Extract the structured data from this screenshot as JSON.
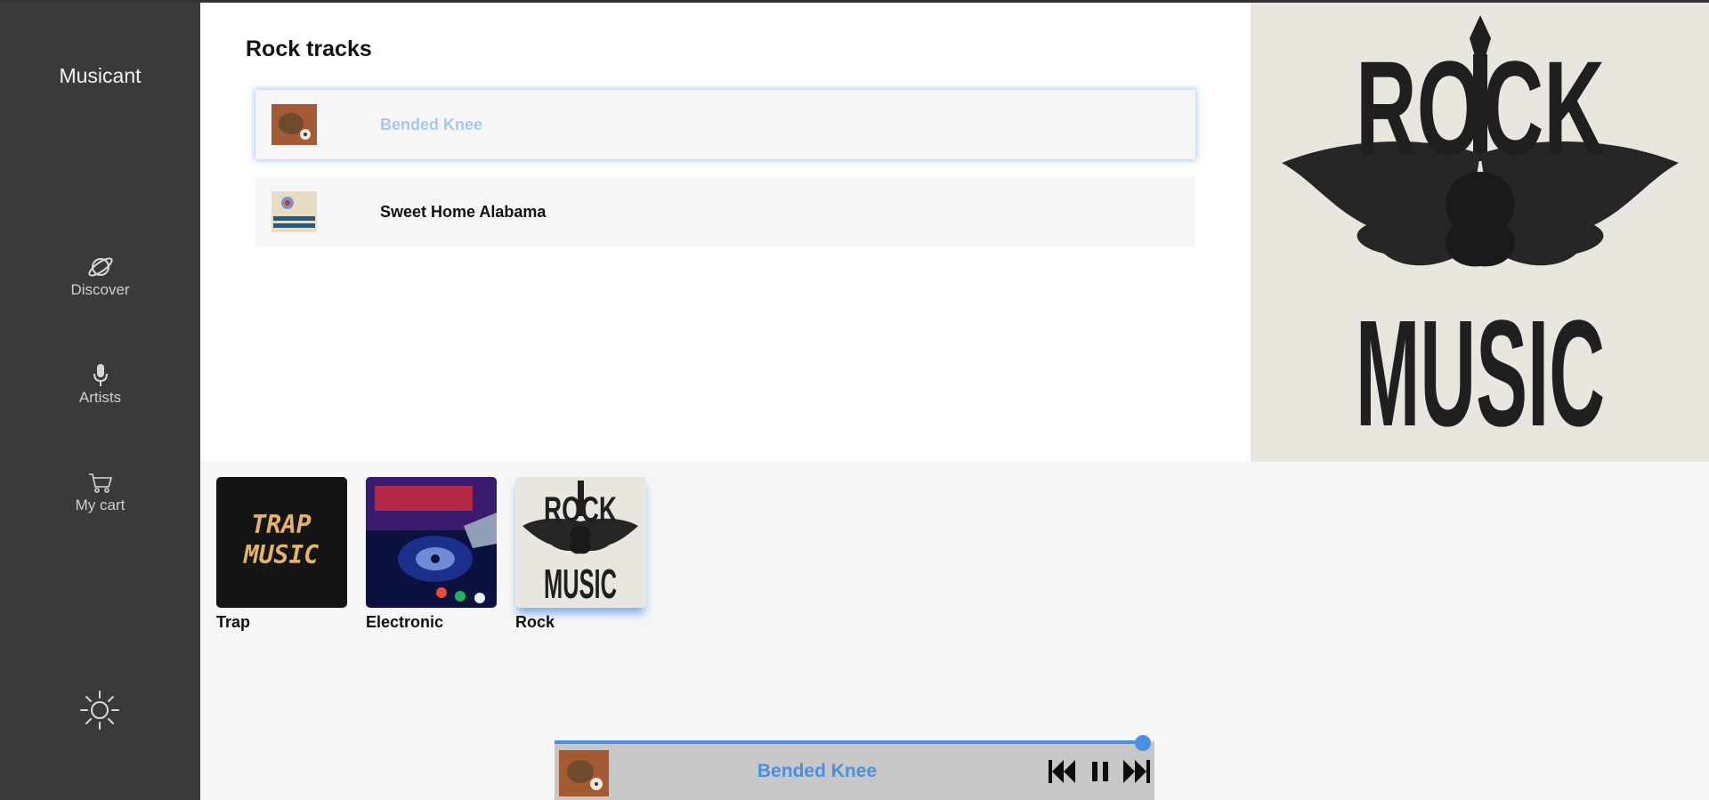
{
  "app": {
    "brand": "Musicant"
  },
  "sidebar": {
    "items": [
      {
        "label": "Discover",
        "icon": "planet-icon"
      },
      {
        "label": "Artists",
        "icon": "microphone-icon"
      },
      {
        "label": "My cart",
        "icon": "cart-icon"
      }
    ],
    "theme_toggle_icon": "sun-icon"
  },
  "tracks": {
    "heading": "Rock tracks",
    "items": [
      {
        "title": "Bended Knee",
        "active": true
      },
      {
        "title": "Sweet Home Alabama",
        "active": false
      }
    ]
  },
  "hero": {
    "logo_top": "ROCK",
    "logo_bottom": "MUSIC"
  },
  "genres": {
    "items": [
      {
        "name": "Trap",
        "cover_text": "TRAP MUSIC"
      },
      {
        "name": "Electronic"
      },
      {
        "name": "Rock",
        "active": true,
        "cover_text_top": "ROCK",
        "cover_text_bottom": "MUSIC"
      }
    ]
  },
  "player": {
    "now_playing": "Bended Knee",
    "progress": 0.98,
    "accent": "#4a90e2",
    "controls": [
      "previous-icon",
      "pause-icon",
      "next-icon"
    ]
  }
}
